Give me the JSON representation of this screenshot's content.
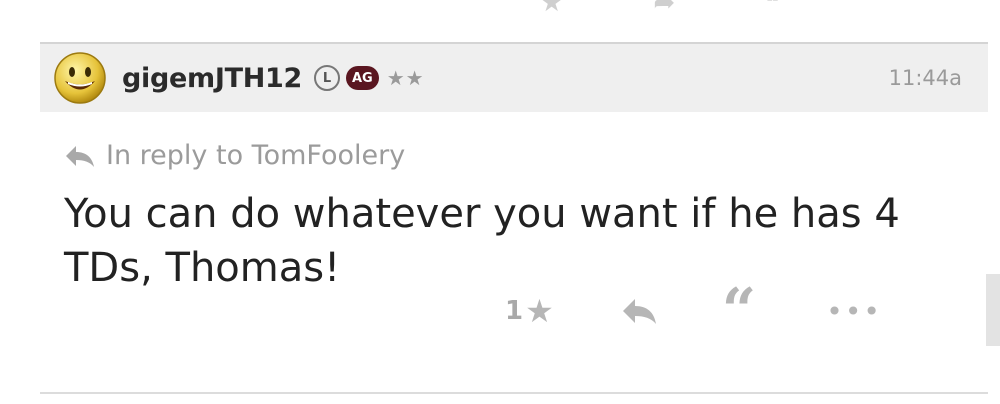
{
  "post": {
    "username": "gigemJTH12",
    "badge_level": "L",
    "badge_team": "AG",
    "stars": "★★",
    "time": "11:44a",
    "reply_to": "In reply to TomFoolery",
    "message": "You can do whatever you want if he has 4 TDs, Thomas!",
    "like_count": "1"
  },
  "colors": {
    "header_bg": "#efefef",
    "badge_team_bg": "#5a1620",
    "muted_text": "#9b9b9b"
  },
  "icons": {
    "avatar": "smiley-avatar",
    "reply_indicator": "reply-arrow-icon",
    "like": "star-icon",
    "reply": "reply-icon",
    "quote": "quote-icon",
    "more": "more-icon"
  }
}
